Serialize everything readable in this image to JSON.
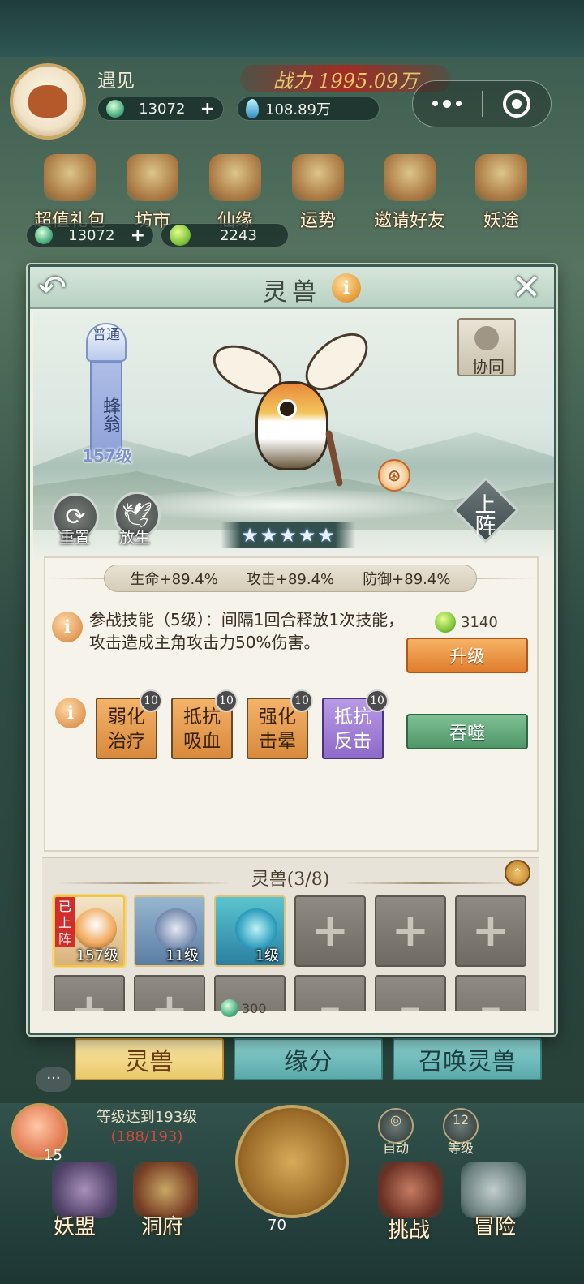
{
  "player": {
    "name": "遇见",
    "jade": "13072",
    "spirit_gems": "108.89万",
    "power": "战力 1995.09万"
  },
  "top_menu": [
    {
      "label": "超值礼包",
      "icon": "gift-bag-icon"
    },
    {
      "label": "坊市",
      "icon": "market-icon"
    },
    {
      "label": "仙缘",
      "icon": "lotus-icon"
    },
    {
      "label": "运势",
      "icon": "fortune-icon"
    },
    {
      "label": "邀请好友",
      "icon": "invite-book-icon"
    },
    {
      "label": "妖途",
      "icon": "demon-path-icon"
    }
  ],
  "currency": {
    "jade": "13072",
    "spirit_fruit": "2243"
  },
  "modal": {
    "title": "灵兽",
    "info": "i",
    "back": "↶",
    "close": "✕"
  },
  "beast": {
    "rarity": "普通",
    "name": "蜂翁",
    "level": "157级",
    "stars": 5,
    "star_glyph": "★",
    "coop_label": "协同",
    "deploy_label": "上阵",
    "reset_label": "重置",
    "release_label": "放生"
  },
  "stats": {
    "hp": "生命+89.4%",
    "atk": "攻击+89.4%",
    "def": "防御+89.4%"
  },
  "skill": {
    "info": "i",
    "description": "参战技能（5级）：间隔1回合释放1次技能，攻击造成主角攻击力50%伤害。",
    "cost": "3140",
    "upgrade_label": "升级"
  },
  "traits": {
    "info": "i",
    "items": [
      {
        "name": "弱化治疗",
        "level": "10",
        "color": "orange"
      },
      {
        "name": "抵抗吸血",
        "level": "10",
        "color": "orange"
      },
      {
        "name": "强化击晕",
        "level": "10",
        "color": "orange"
      },
      {
        "name": "抵抗反击",
        "level": "10",
        "color": "purple"
      }
    ],
    "devour_label": "吞噬"
  },
  "roster": {
    "title": "灵兽(3/8)",
    "collapse": "⌃",
    "deployed_tag": "已上阵",
    "slots": [
      {
        "level": "157级"
      },
      {
        "level": "11级"
      },
      {
        "level": "1级"
      }
    ],
    "unlock_cost": "300"
  },
  "tabs": {
    "beast": "灵兽",
    "fate": "缘分",
    "summon": "召唤灵兽"
  },
  "hud": {
    "task": "等级达到193级",
    "task_progress": "(188/193)",
    "peach_count": "15",
    "axe_count": "70",
    "auto_label": "自动",
    "level_num": "12",
    "level_label": "等级",
    "nav": [
      "妖盟",
      "洞府",
      "挑战",
      "冒险"
    ]
  },
  "colors": {
    "accent_orange": "#e07d2e",
    "accent_green": "#4e9668",
    "purple_trait": "#8e6ac9",
    "deployed_red": "#d22d2d"
  }
}
